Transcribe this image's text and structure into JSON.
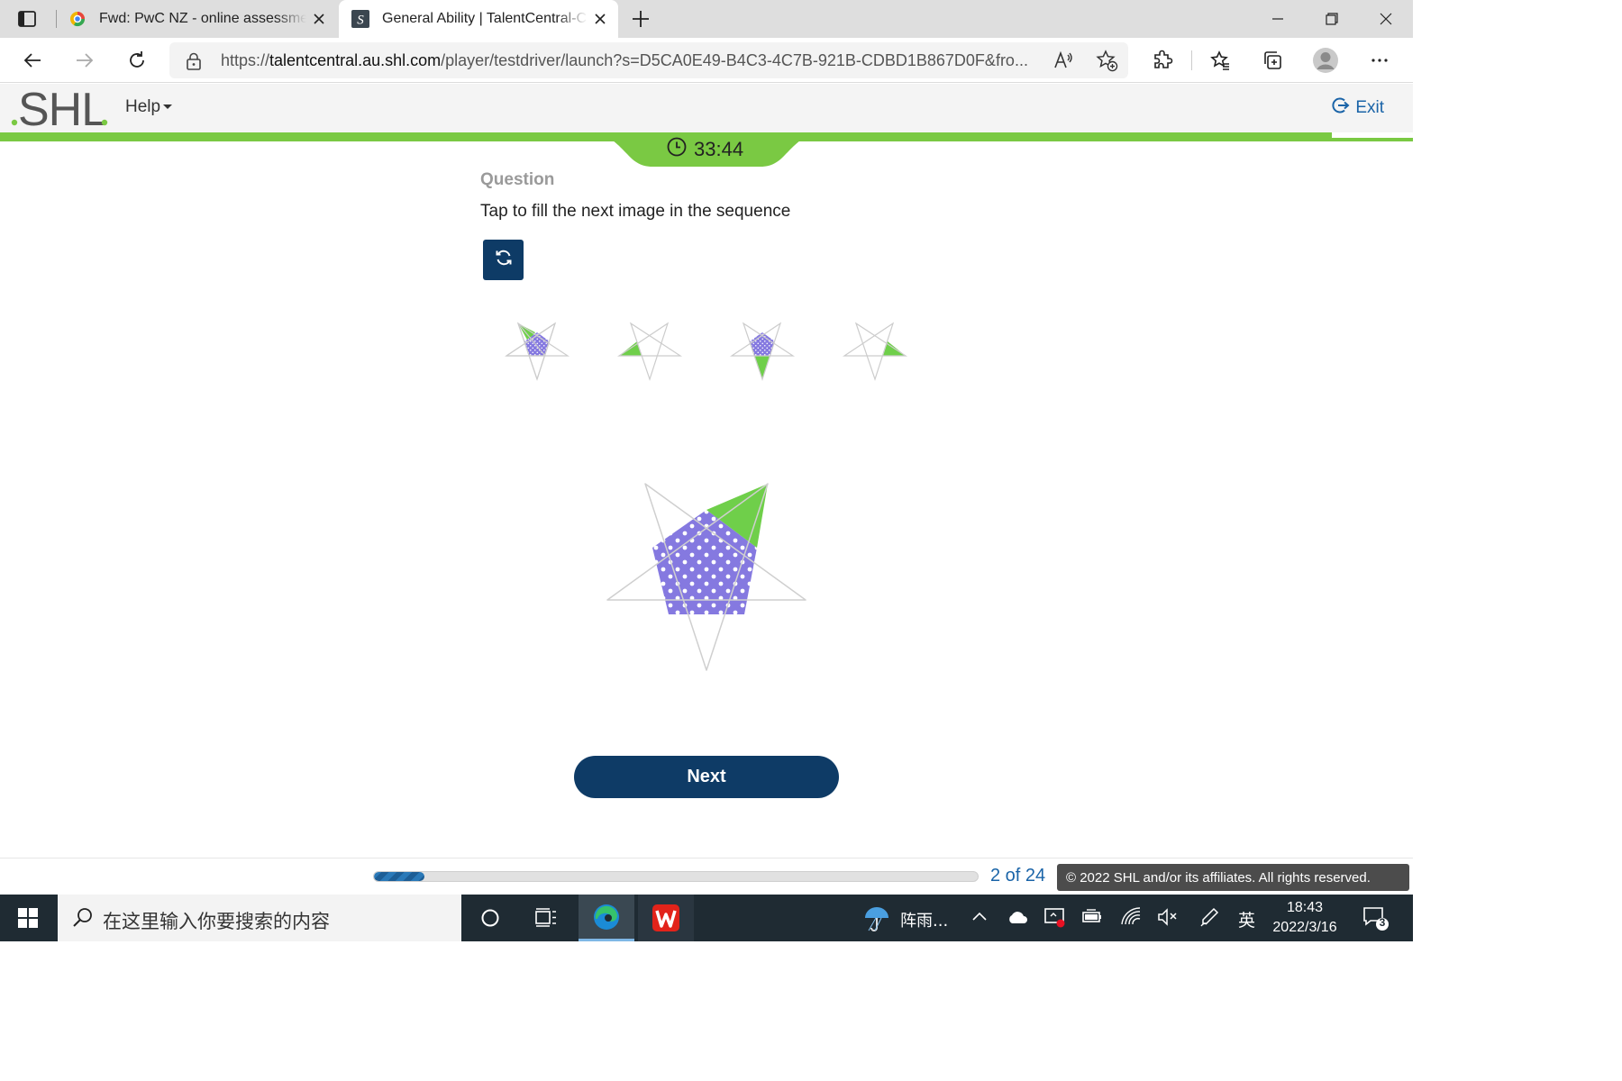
{
  "browser": {
    "tabs": [
      {
        "title": "Fwd: PwC NZ - online assessment",
        "active": false,
        "icon": "mail-app-icon"
      },
      {
        "title": "General Ability | TalentCentral-Candidate",
        "active": true,
        "icon": "shl-s-icon"
      }
    ],
    "url_prefix": "https://",
    "url_host": "talentcentral.au.shl.com",
    "url_path": "/player/testdriver/launch?s=D5CA0E49-B4C3-4C7B-921B-CDBD1B867D0F&fro..."
  },
  "app": {
    "logo": ".SHL.",
    "help_label": "Help",
    "exit_label": "Exit",
    "timer": "33:44"
  },
  "question": {
    "label": "Question",
    "prompt": "Tap to fill the next image in the sequence",
    "sequence_count": 4
  },
  "actions": {
    "next_label": "Next"
  },
  "footer": {
    "progress_fraction": 0.083,
    "progress_label": "2 of 24",
    "copyright": "© 2022 SHL and/or its affiliates. All rights reserved."
  },
  "taskbar": {
    "search_placeholder": "在这里输入你要搜索的内容",
    "weather": "阵雨...",
    "ime": "英",
    "time": "18:43",
    "date": "2022/3/16",
    "notification_count": "3"
  },
  "colors": {
    "brand_green": "#7ac943",
    "navy": "#0e3b66",
    "link_blue": "#1a64a8",
    "pentagon_purple": "#8579e0",
    "triangle_green": "#6fcf4a"
  }
}
